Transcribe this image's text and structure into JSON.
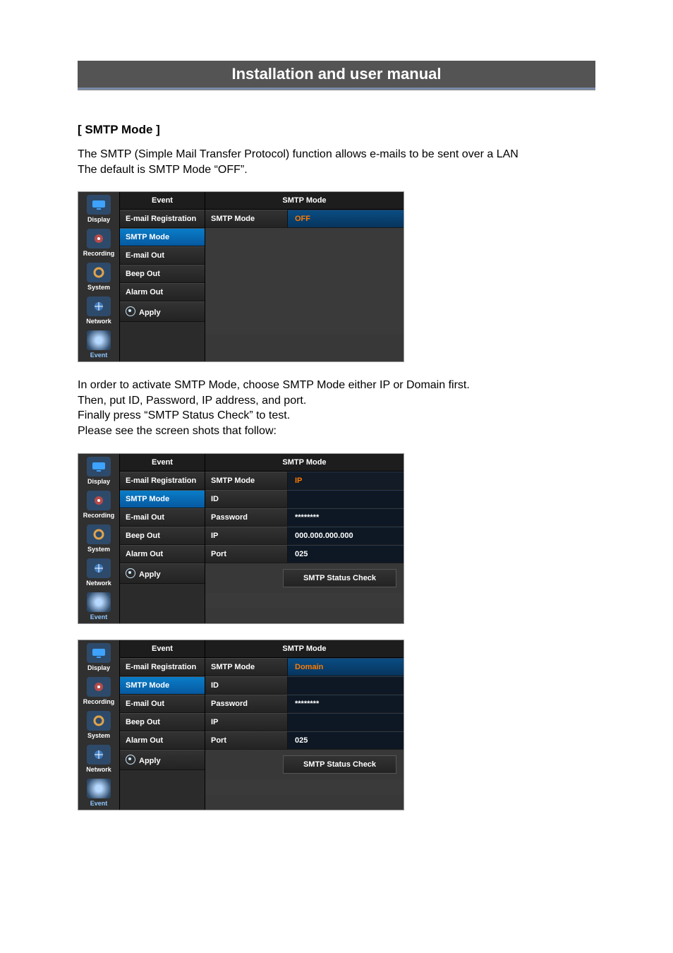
{
  "header": {
    "title": "Installation and user manual"
  },
  "section": {
    "heading": "[ SMTP Mode ]",
    "intro_l1": "The SMTP (Simple Mail Transfer Protocol) function allows e-mails to be sent over a LAN",
    "intro_l2": "The default is SMTP Mode “OFF”.",
    "mid_l1": "In order to activate SMTP Mode, choose SMTP Mode either IP or Domain first.",
    "mid_l2": "Then, put ID, Password, IP address, and port.",
    "mid_l3": "Finally press “SMTP Status Check” to test.",
    "mid_l4": "Please see the screen shots that follow:"
  },
  "rail": {
    "display": "Display",
    "recording": "Recording",
    "system": "System",
    "network": "Network",
    "event": "Event"
  },
  "menu": {
    "header": "Event",
    "items": {
      "email_reg": "E-mail Registration",
      "smtp_mode": "SMTP Mode",
      "email_out": "E-mail Out",
      "beep_out": "Beep Out",
      "alarm_out": "Alarm Out",
      "apply": "Apply"
    }
  },
  "panel": {
    "header": "SMTP Mode",
    "labels": {
      "smtp_mode": "SMTP Mode",
      "id": "ID",
      "password": "Password",
      "ip": "IP",
      "port": "Port"
    },
    "status_check": "SMTP Status Check"
  },
  "shot1": {
    "smtp_mode_value": "OFF"
  },
  "shot2": {
    "smtp_mode_value": "IP",
    "id": "",
    "password": "********",
    "ip": "000.000.000.000",
    "port": "025"
  },
  "shot3": {
    "smtp_mode_value": "Domain",
    "id": "",
    "password": "********",
    "ip": "",
    "port": "025"
  }
}
